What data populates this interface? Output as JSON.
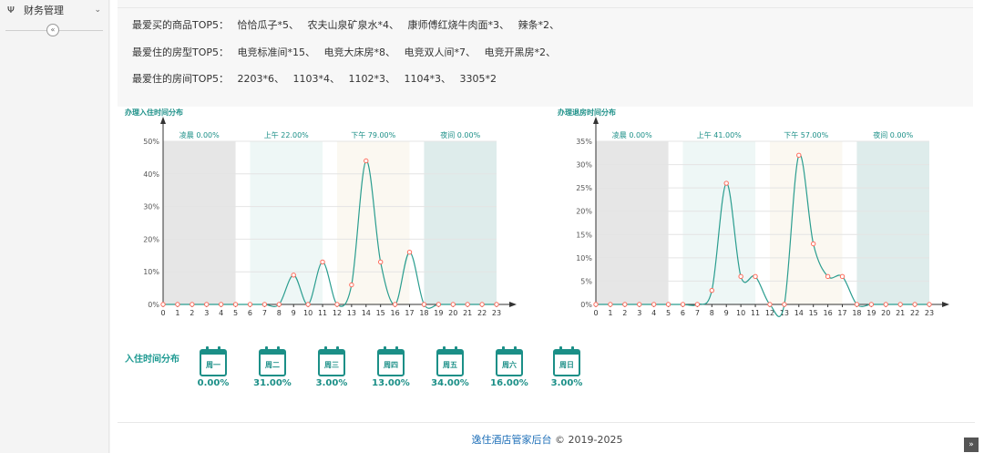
{
  "sidebar": {
    "menu_label": "财务管理",
    "menu_icon": "fork-knife-icon",
    "collapse_glyph": "«"
  },
  "top5": {
    "goods": {
      "label": "最爱买的商品TOP5：",
      "items": [
        "恰恰瓜子*5、",
        "农夫山泉矿泉水*4、",
        "康师傅红烧牛肉面*3、",
        "辣条*2、"
      ]
    },
    "room_types": {
      "label": "最爱住的房型TOP5：",
      "items": [
        "电竞标准间*15、",
        "电竞大床房*8、",
        "电竞双人间*7、",
        "电竞开黑房*2、"
      ]
    },
    "rooms": {
      "label": "最爱住的房间TOP5：",
      "items": [
        "2203*6、",
        "1103*4、",
        "1102*3、",
        "1104*3、",
        "3305*2"
      ]
    }
  },
  "chart_data": [
    {
      "type": "line",
      "title": "办理入住时间分布",
      "x": [
        0,
        1,
        2,
        3,
        4,
        5,
        6,
        7,
        8,
        9,
        10,
        11,
        12,
        13,
        14,
        15,
        16,
        17,
        18,
        19,
        20,
        21,
        22,
        23
      ],
      "values": [
        0,
        0,
        0,
        0,
        0,
        0,
        0,
        0,
        0,
        9,
        0,
        13,
        0,
        6,
        44,
        13,
        0,
        16,
        0,
        0,
        0,
        0,
        0,
        0
      ],
      "ylim": [
        0,
        50
      ],
      "yticks": [
        "0%",
        "10%",
        "20%",
        "30%",
        "40%",
        "50%"
      ],
      "y_tick_values": [
        0,
        10,
        20,
        30,
        40,
        50
      ],
      "periods": [
        {
          "name": "凌晨",
          "value": "0.00%",
          "from": 0,
          "to": 5,
          "color": "#e6e6e6"
        },
        {
          "name": "上午",
          "value": "22.00%",
          "from": 6,
          "to": 11,
          "color": "#eef7f6"
        },
        {
          "name": "下午",
          "value": "79.00%",
          "from": 12,
          "to": 17,
          "color": "#fbf8f1"
        },
        {
          "name": "夜间",
          "value": "0.00%",
          "from": 18,
          "to": 23,
          "color": "#deeceb"
        }
      ]
    },
    {
      "type": "line",
      "title": "办理退房时间分布",
      "x": [
        0,
        1,
        2,
        3,
        4,
        5,
        6,
        7,
        8,
        9,
        10,
        11,
        12,
        13,
        14,
        15,
        16,
        17,
        18,
        19,
        20,
        21,
        22,
        23
      ],
      "values": [
        0,
        0,
        0,
        0,
        0,
        0,
        0,
        0,
        3,
        26,
        6,
        6,
        0,
        0,
        32,
        13,
        6,
        6,
        0,
        0,
        0,
        0,
        0,
        0
      ],
      "ylim": [
        0,
        35
      ],
      "yticks": [
        "0%",
        "5%",
        "10%",
        "15%",
        "20%",
        "25%",
        "30%",
        "35%"
      ],
      "y_tick_values": [
        0,
        5,
        10,
        15,
        20,
        25,
        30,
        35
      ],
      "periods": [
        {
          "name": "凌晨",
          "value": "0.00%",
          "from": 0,
          "to": 5,
          "color": "#e6e6e6"
        },
        {
          "name": "上午",
          "value": "41.00%",
          "from": 6,
          "to": 11,
          "color": "#eef7f6"
        },
        {
          "name": "下午",
          "value": "57.00%",
          "from": 12,
          "to": 17,
          "color": "#fbf8f1"
        },
        {
          "name": "夜间",
          "value": "0.00%",
          "from": 18,
          "to": 23,
          "color": "#deeceb"
        }
      ]
    }
  ],
  "weekday": {
    "title": "入住时间分布",
    "items": [
      {
        "day": "周一",
        "pct": "0.00%"
      },
      {
        "day": "周二",
        "pct": "31.00%"
      },
      {
        "day": "周三",
        "pct": "3.00%"
      },
      {
        "day": "周四",
        "pct": "13.00%"
      },
      {
        "day": "周五",
        "pct": "34.00%"
      },
      {
        "day": "周六",
        "pct": "16.00%"
      },
      {
        "day": "周日",
        "pct": "3.00%"
      }
    ]
  },
  "footer": {
    "brand": "逸住酒店管家后台",
    "copyright": "© 2019-2025"
  },
  "back_top_glyph": "»",
  "colors": {
    "accent": "#1b8f87",
    "line": "#2a9d8f",
    "point": "#ff6b5b"
  }
}
